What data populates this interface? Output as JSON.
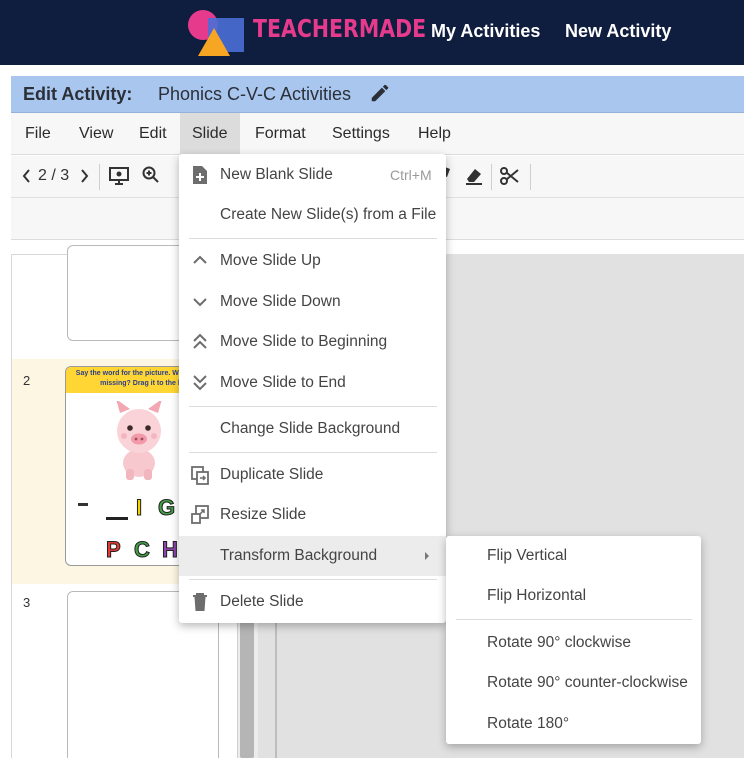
{
  "header": {
    "brand": "TEACHERMADE",
    "nav": [
      "My Activities",
      "New Activity"
    ]
  },
  "edit": {
    "label": "Edit Activity:",
    "title": "Phonics C-V-C Activities"
  },
  "menubar": {
    "items": [
      "File",
      "View",
      "Edit",
      "Slide",
      "Format",
      "Settings",
      "Help"
    ],
    "active": "Slide"
  },
  "toolbar": {
    "page_indicator": "2 / 3"
  },
  "slides": [
    {
      "number": ""
    },
    {
      "number": "2",
      "banner": "Say the word for the picture. What letter is missing? Drag it to the line.",
      "word_letters": [
        "I",
        "G"
      ],
      "choice_letters": [
        "P",
        "C",
        "H"
      ]
    },
    {
      "number": "3"
    }
  ],
  "slide_menu": {
    "items": [
      {
        "label": "New Blank Slide",
        "shortcut": "Ctrl+M",
        "icon": "add-slide-icon"
      },
      {
        "label": "Create New Slide(s) from a File",
        "icon": ""
      },
      {
        "label": "Move Slide Up",
        "icon": "chevron-up-icon"
      },
      {
        "label": "Move Slide Down",
        "icon": "chevron-down-icon"
      },
      {
        "label": "Move Slide to Beginning",
        "icon": "double-chevron-up-icon"
      },
      {
        "label": "Move Slide to End",
        "icon": "double-chevron-down-icon"
      },
      {
        "label": "Change Slide Background",
        "icon": ""
      },
      {
        "label": "Duplicate Slide",
        "icon": "duplicate-icon"
      },
      {
        "label": "Resize Slide",
        "icon": "resize-icon"
      },
      {
        "label": "Transform Background",
        "icon": "",
        "has_submenu": true
      },
      {
        "label": "Delete Slide",
        "icon": "trash-icon"
      }
    ]
  },
  "transform_submenu": {
    "items": [
      "Flip Vertical",
      "Flip Horizontal",
      "Rotate 90° clockwise",
      "Rotate 90° counter-clockwise",
      "Rotate 180°"
    ]
  },
  "colors": {
    "topnav": "#0f1d3f",
    "brand": "#e63b8c",
    "edit_header": "#a9c7ee",
    "menu_hover": "#ececec",
    "slide_selected": "#fdf6e3"
  }
}
